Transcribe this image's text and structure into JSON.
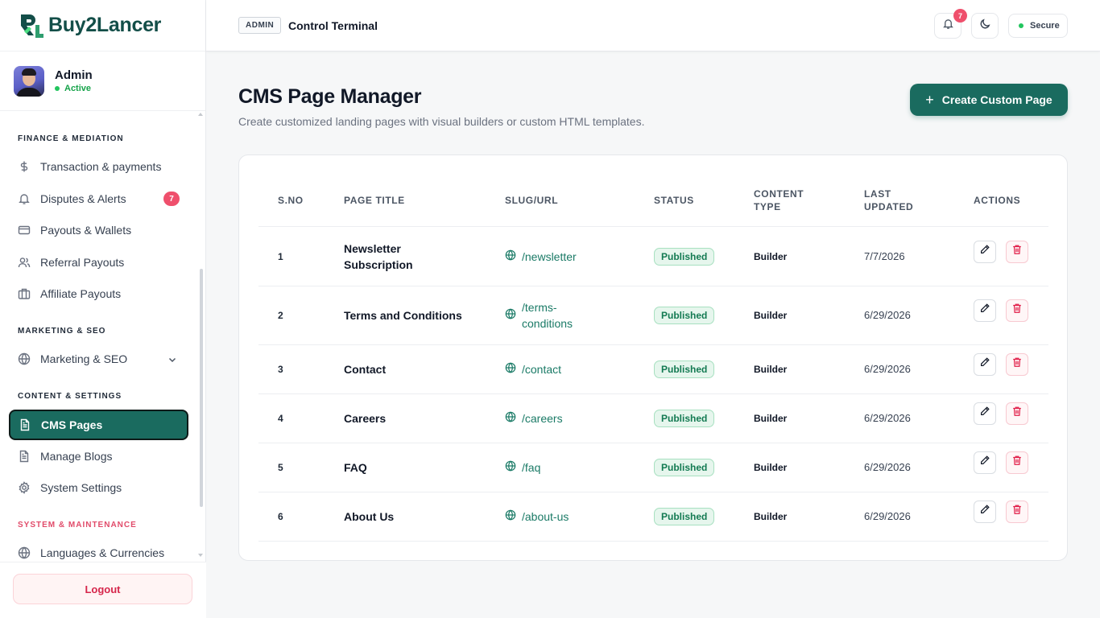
{
  "app": {
    "logo_text": "Buy2Lancer"
  },
  "user": {
    "name": "Admin",
    "status": "Active"
  },
  "sidebar": {
    "sections": [
      {
        "title": "FINANCE & MEDIATION"
      },
      {
        "title": "MARKETING & SEO"
      },
      {
        "title": "CONTENT & SETTINGS"
      },
      {
        "title": "SYSTEM & MAINTENANCE"
      }
    ],
    "items": [
      {
        "label": "Transaction & payments",
        "icon": "dollar-icon"
      },
      {
        "label": "Disputes & Alerts",
        "icon": "bell-icon",
        "badge": "7"
      },
      {
        "label": "Payouts & Wallets",
        "icon": "card-icon"
      },
      {
        "label": "Referral Payouts",
        "icon": "users-icon"
      },
      {
        "label": "Affiliate Payouts",
        "icon": "briefcase-icon"
      },
      {
        "label": "Marketing & SEO",
        "icon": "globe-icon"
      },
      {
        "label": "CMS Pages",
        "icon": "document-icon",
        "active": true
      },
      {
        "label": "Manage Blogs",
        "icon": "document-icon"
      },
      {
        "label": "System Settings",
        "icon": "gear-icon"
      },
      {
        "label": "Languages & Currencies",
        "icon": "globe-icon"
      }
    ],
    "logout_label": "Logout"
  },
  "header": {
    "tag": "ADMIN",
    "title": "Control Terminal",
    "notification_count": "7",
    "secure_label": "Secure"
  },
  "main": {
    "title": "CMS Page Manager",
    "subtitle": "Create customized landing pages with visual builders or custom HTML templates.",
    "create_button": "Create Custom Page",
    "table": {
      "headers": [
        "S.NO",
        "PAGE TITLE",
        "SLUG/URL",
        "STATUS",
        "CONTENT TYPE",
        "LAST UPDATED",
        "ACTIONS"
      ],
      "rows": [
        {
          "sno": "1",
          "title": "Newsletter Subscription",
          "slug": "/newsletter",
          "status": "Published",
          "type": "Builder",
          "updated": "7/7/2026"
        },
        {
          "sno": "2",
          "title": "Terms and Conditions",
          "slug": "/terms-conditions",
          "status": "Published",
          "type": "Builder",
          "updated": "6/29/2026"
        },
        {
          "sno": "3",
          "title": "Contact",
          "slug": "/contact",
          "status": "Published",
          "type": "Builder",
          "updated": "6/29/2026"
        },
        {
          "sno": "4",
          "title": "Careers",
          "slug": "/careers",
          "status": "Published",
          "type": "Builder",
          "updated": "6/29/2026"
        },
        {
          "sno": "5",
          "title": "FAQ",
          "slug": "/faq",
          "status": "Published",
          "type": "Builder",
          "updated": "6/29/2026"
        },
        {
          "sno": "6",
          "title": "About Us",
          "slug": "/about-us",
          "status": "Published",
          "type": "Builder",
          "updated": "6/29/2026"
        }
      ]
    }
  },
  "colors": {
    "brand": "#1a6b5f",
    "danger": "#ef4f6c",
    "success": "#22c55e"
  }
}
